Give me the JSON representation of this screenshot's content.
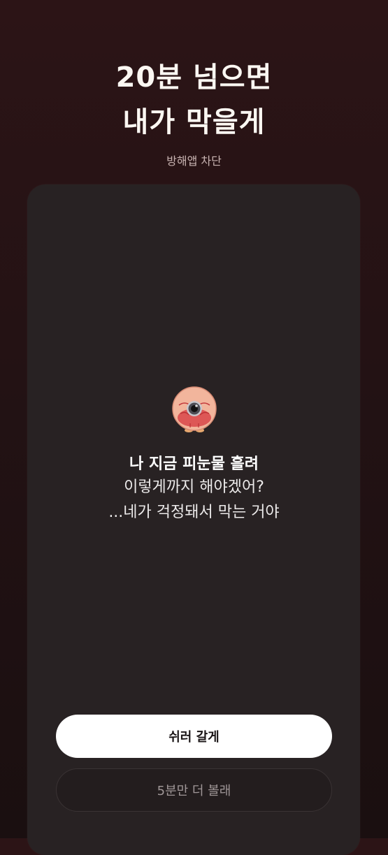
{
  "header": {
    "title_line1": "20분 넘으면",
    "title_line2": "내가 막을게",
    "subtitle": "방해앱 차단"
  },
  "card": {
    "mascot_icon": "crying-eye-mascot-icon",
    "message_bold": "나 지금 피눈물 흘려",
    "message_line2": "이렇게까지 해야겠어?",
    "message_line3": "...네가 걱정돼서 막는 거야"
  },
  "buttons": {
    "primary_label": "쉬러 갈게",
    "secondary_label": "5분만 더 볼래"
  },
  "colors": {
    "background_top": "#2c1416",
    "card": "#282223",
    "primary_button": "#ffffff",
    "secondary_button": "#231d1e"
  }
}
